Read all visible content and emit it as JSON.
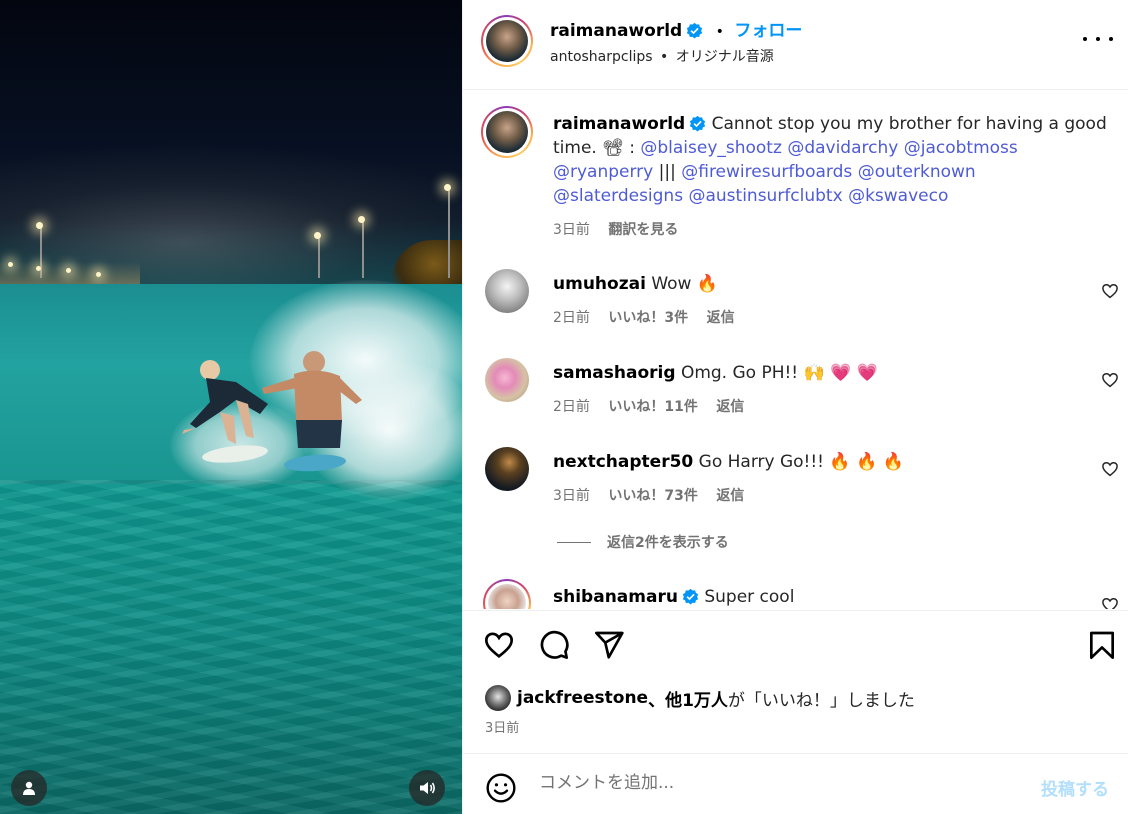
{
  "post": {
    "username": "raimanaworld",
    "separator": "•",
    "follow_label": "フォロー",
    "audio_user": "antosharpclips",
    "audio_sep": "•",
    "audio_name": "オリジナル音源"
  },
  "caption": {
    "username": "raimanaworld",
    "text_before": "Cannot stop you my brother for having a good time. 📽 : ",
    "mentions_line1": [
      "@blaisey_shootz",
      "@davidarchy",
      "@jacobtmoss"
    ],
    "mention_ryan": "@ryanperry",
    "separator": " ||| ",
    "mentions_line3": [
      "@firewiresurfboards",
      "@outerknown"
    ],
    "mentions_line4": [
      "@slaterdesigns",
      "@austinsurfclubtx",
      "@kswaveco"
    ],
    "time": "3日前",
    "translate": "翻訳を見る"
  },
  "comments": [
    {
      "username": "umuhozai",
      "text": "Wow 🔥",
      "time": "2日前",
      "likes": "いいね！3件",
      "reply": "返信"
    },
    {
      "username": "samashaorig",
      "text": "Omg. Go PH!! 🙌 💗 💗",
      "time": "2日前",
      "likes": "いいね！11件",
      "reply": "返信"
    },
    {
      "username": "nextchapter50",
      "text": "Go Harry Go!!! 🔥 🔥 🔥",
      "time": "3日前",
      "likes": "いいね！73件",
      "reply": "返信"
    },
    {
      "username": "shibanamaru",
      "text": "Super cool",
      "time": "",
      "likes": "",
      "reply": ""
    }
  ],
  "view_replies": "返信2件を表示する",
  "likes_line": {
    "user": "jackfreestone",
    "others": "、他1万人",
    "suffix": "が「いいね！」しました"
  },
  "post_date": "3日前",
  "comment_box": {
    "placeholder": "コメントを追加...",
    "post_label": "投稿する"
  },
  "colors": {
    "link": "#4f5bd5",
    "follow": "#0095f6",
    "verified": "#0095f6",
    "post_disabled": "#b2dffc",
    "meta": "#737373"
  },
  "icons": [
    "verified-badge-icon",
    "more-options-icon",
    "heart-icon",
    "comment-icon",
    "share-icon",
    "save-icon",
    "emoji-icon",
    "user-tag-icon",
    "volume-icon"
  ]
}
